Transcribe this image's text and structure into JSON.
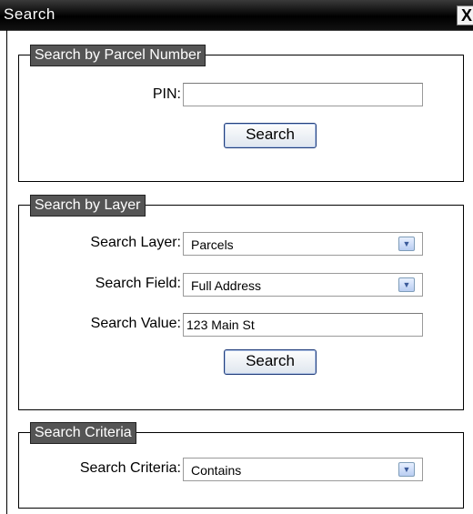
{
  "window": {
    "title": "Search",
    "close_glyph": "X"
  },
  "parcel_group": {
    "legend": "Search by Parcel Number",
    "pin_label": "PIN:",
    "pin_value": "",
    "search_button": "Search"
  },
  "layer_group": {
    "legend": "Search by Layer",
    "layer_label": "Search Layer:",
    "layer_value": "Parcels",
    "field_label": "Search Field:",
    "field_value": "Full Address",
    "value_label": "Search Value:",
    "value_value": "123 Main St",
    "search_button": "Search"
  },
  "criteria_group": {
    "legend": "Search Criteria",
    "criteria_label": "Search Criteria:",
    "criteria_value": "Contains"
  },
  "icons": {
    "dropdown": "chevron-down-icon",
    "close": "close-icon"
  }
}
